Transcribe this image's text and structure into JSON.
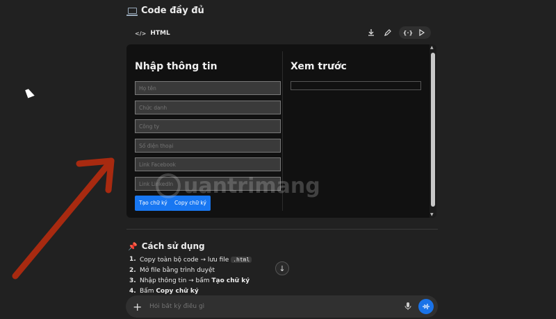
{
  "section": {
    "title": "Code đầy đủ",
    "icon": "laptop-icon"
  },
  "code_block": {
    "language": "HTML",
    "tools": [
      "download-icon",
      "edit-icon",
      "code-braces-icon",
      "play-icon"
    ],
    "preview": {
      "form_title": "Nhập thông tin",
      "fields": [
        "Họ tên",
        "Chức danh",
        "Công ty",
        "Số điện thoại",
        "Link Facebook",
        "Link LinkedIn"
      ],
      "buttons": [
        "Tạo chữ ký",
        "Copy chữ ký"
      ],
      "preview_title": "Xem trước"
    }
  },
  "usage": {
    "title": "Cách sử dụng",
    "steps": [
      {
        "num": "1.",
        "text": "Copy toàn bộ code → lưu file",
        "chip": ".html"
      },
      {
        "num": "2.",
        "text": "Mở file bằng trình duyệt"
      },
      {
        "num": "3.",
        "text_prefix": "Nhập thông tin → bấm ",
        "bold": "Tạo chữ ký"
      },
      {
        "num": "4.",
        "text_prefix": "Bấm ",
        "bold": "Copy chữ ký"
      }
    ]
  },
  "chat": {
    "placeholder": "Hỏi bất kỳ điều gì"
  },
  "watermark": {
    "text": "uantrimang"
  },
  "colors": {
    "accent": "#1877f2",
    "arrow": "#a82a10",
    "background": "#212121"
  }
}
